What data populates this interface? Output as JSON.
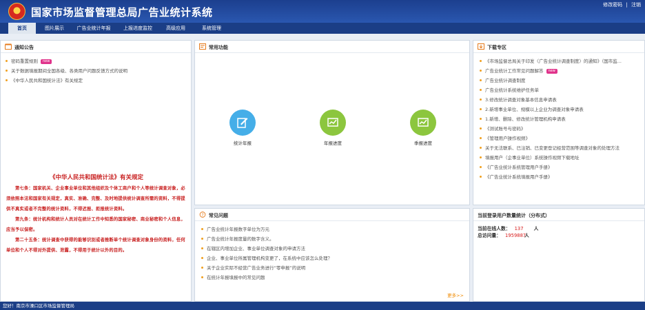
{
  "header": {
    "title": "国家市场监督管理总局广告业统计系统",
    "links": [
      "修改密码",
      "|",
      "注销"
    ]
  },
  "nav": [
    {
      "label": "首页",
      "active": true
    },
    {
      "label": "图片展示"
    },
    {
      "label": "广告业统计年报"
    },
    {
      "label": "上报进度监控"
    },
    {
      "label": "高级应用"
    },
    {
      "label": "系统管理"
    }
  ],
  "notice": {
    "title": "通知公告",
    "items": [
      {
        "text": "密码重置规则",
        "new": true
      },
      {
        "text": "关于数据填报期间全国各级、各类用户问题反馈方式的说明"
      },
      {
        "text": "《中华人民共和国统计法》有关规定"
      }
    ],
    "new_label": "new"
  },
  "law": {
    "title": "《中华人民共和国统计法》有关规定",
    "paragraphs": [
      "第七条：国家机关、企业事业单位和其他组织及个体工商户和个人等统计调查对象，必须依照本法和国家有关规定，真实、准确、完整、及时地提供统计调查所需的资料，不得提供不真实或者不完整的统计资料，不得迟报、拒报统计资料。",
      "第九条：统计机构和统计人员对在统计工作中知悉的国家秘密、商业秘密和个人信息，应当予以保密。",
      "第二十五条：统计调查中获得的能够识别或者推断单个统计调查对象身份的资料，任何单位和个人不得对外提供、泄露，不得用于统计以外的目的。"
    ]
  },
  "functions": {
    "title": "常用功能",
    "items": [
      {
        "label": "统计年报",
        "color": "#45aee8",
        "icon": "report-edit-icon"
      },
      {
        "label": "年报进度",
        "color": "#8cc63e",
        "icon": "chart-icon"
      },
      {
        "label": "季报进度",
        "color": "#8cc63e",
        "icon": "chart-icon"
      }
    ]
  },
  "faq": {
    "title": "常见问题",
    "items": [
      "广告业统计年报数字单位为万元",
      "广告业统计年报度量的数字含义。",
      "在辖区内增加企业、事业单位调查对象的申请方法",
      "企业、事业单位所属管理机构变更了，在系统中应该怎么处理？",
      "关于企业实际不经营广告业务进行“零申报”的说明",
      "在统计年报填报中的常见问题"
    ],
    "more": "更多>>"
  },
  "downloads": {
    "title": "下载专区",
    "items": [
      {
        "text": "《市场监督总局关于印发〈广告业统计调查制度〉的通知》（国市监..."
      },
      {
        "text": "广告业统计工作常见问题解答",
        "new": true
      },
      {
        "text": "广告业统计调查制度"
      },
      {
        "text": "广告业统计系统维护任务单"
      },
      {
        "text": "3.修改统计调查对象基本信息申请表"
      },
      {
        "text": "2.新增事业单位、规模以上企业为调查对象申请表"
      },
      {
        "text": "1.新增、删除、修改统计管理机构申请表"
      },
      {
        "text": "《测试账号与密码》"
      },
      {
        "text": "《管理用户操作视频》"
      },
      {
        "text": "关于无法联系、已注销、已变更登记经营范围等调查对象的处理方法"
      },
      {
        "text": "填报用户（企事业单位）系统操作视频下载地址"
      },
      {
        "text": "《广告业统计系统管理用户手册》"
      },
      {
        "text": "《广告业统计系统填报用户手册》"
      }
    ]
  },
  "stats": {
    "title": "当前登录用户数量统计（分布式）",
    "online_label": "当前在线人数：",
    "online_value": "137",
    "online_unit": "人",
    "total_label": "总访问量：",
    "total_value": "1959887",
    "total_unit": "人"
  },
  "footer": {
    "text": "您好！南京市溧口区市场监督管理局"
  }
}
